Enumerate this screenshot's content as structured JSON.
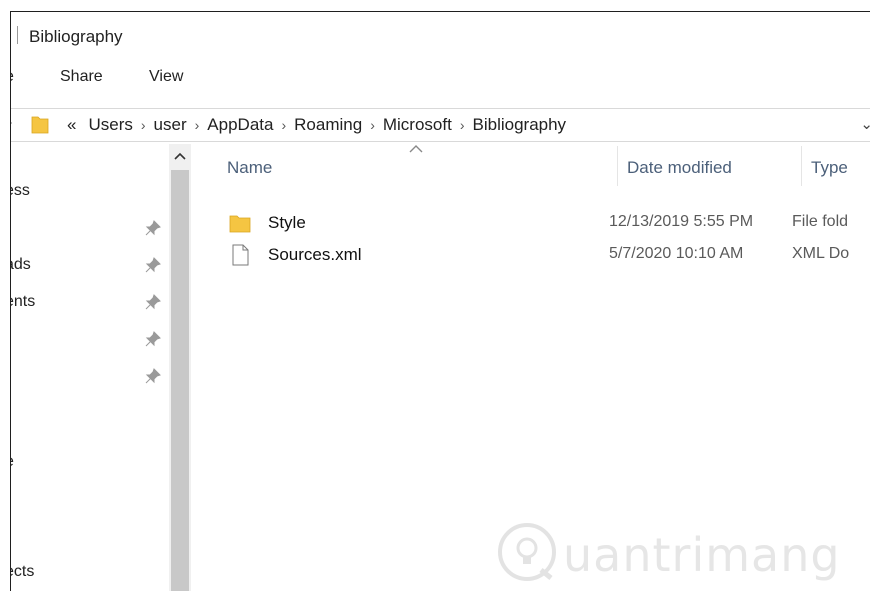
{
  "window": {
    "title": "Bibliography"
  },
  "ribbon": {
    "tabs": [
      "Share",
      "View"
    ],
    "partial_tab": "e"
  },
  "address": {
    "overflow": "«",
    "crumbs": [
      "Users",
      "user",
      "AppData",
      "Roaming",
      "Microsoft",
      "Bibliography"
    ],
    "separator": "›",
    "dropdown": "⌄"
  },
  "nav": {
    "items": [
      "ess",
      "ads",
      "ents",
      "e",
      "ects"
    ],
    "pins": 5,
    "scroll_up": "˄"
  },
  "columns": {
    "name": "Name",
    "date": "Date modified",
    "type": "Type"
  },
  "files": [
    {
      "icon": "folder-icon",
      "name": "Style",
      "date": "12/13/2019 5:55 PM",
      "type": "File fold"
    },
    {
      "icon": "document-icon",
      "name": "Sources.xml",
      "date": "5/7/2020 10:10 AM",
      "type": "XML Do"
    }
  ],
  "watermark": {
    "text": "uantrimang"
  },
  "colors": {
    "folder": "#f5c542",
    "header_text": "#4c607a",
    "scroll_track": "#f0f0f0",
    "scroll_thumb": "#c8c8c8"
  }
}
